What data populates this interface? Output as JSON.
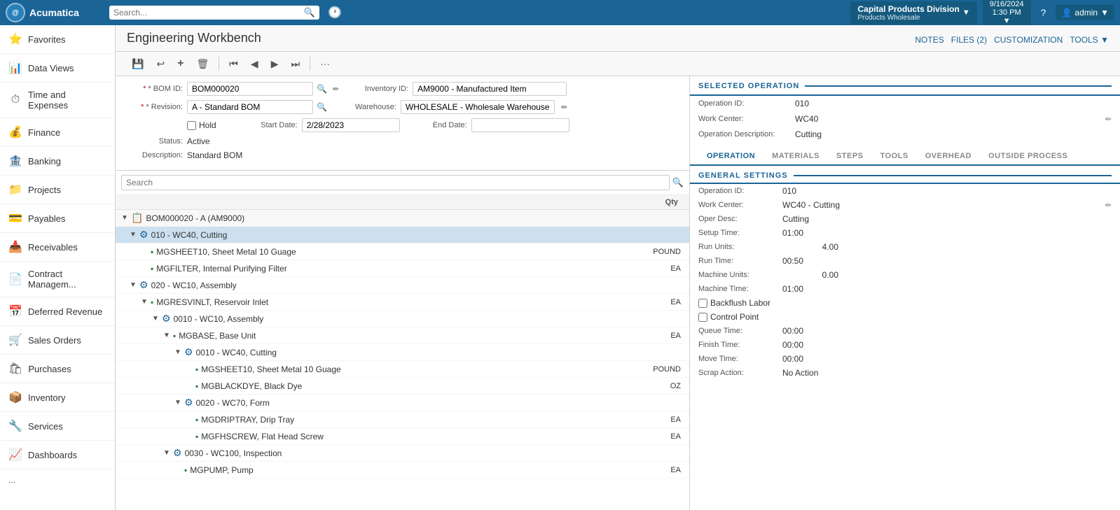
{
  "app": {
    "name": "Acumatica"
  },
  "topnav": {
    "search_placeholder": "Search...",
    "company": "Capital Products Division",
    "division": "Products Wholesale",
    "date": "9/16/2024",
    "time": "1:30 PM",
    "help_label": "?",
    "user": "admin"
  },
  "page": {
    "title": "Engineering Workbench",
    "actions": {
      "notes": "NOTES",
      "files": "FILES (2)",
      "customization": "CUSTOMIZATION",
      "tools": "TOOLS"
    }
  },
  "sidebar": {
    "items": [
      {
        "id": "favorites",
        "label": "Favorites",
        "icon": "⭐"
      },
      {
        "id": "data-views",
        "label": "Data Views",
        "icon": "📊"
      },
      {
        "id": "time-expenses",
        "label": "Time and Expenses",
        "icon": "⏱"
      },
      {
        "id": "finance",
        "label": "Finance",
        "icon": "💰"
      },
      {
        "id": "banking",
        "label": "Banking",
        "icon": "🏦"
      },
      {
        "id": "projects",
        "label": "Projects",
        "icon": "📁"
      },
      {
        "id": "payables",
        "label": "Payables",
        "icon": "💳"
      },
      {
        "id": "receivables",
        "label": "Receivables",
        "icon": "📥"
      },
      {
        "id": "contract-mgmt",
        "label": "Contract Managem...",
        "icon": "📄"
      },
      {
        "id": "deferred-revenue",
        "label": "Deferred Revenue",
        "icon": "📅"
      },
      {
        "id": "sales-orders",
        "label": "Sales Orders",
        "icon": "🛒"
      },
      {
        "id": "purchases",
        "label": "Purchases",
        "icon": "🛍"
      },
      {
        "id": "inventory",
        "label": "Inventory",
        "icon": "📦"
      },
      {
        "id": "services",
        "label": "Services",
        "icon": "🔧"
      },
      {
        "id": "dashboards",
        "label": "Dashboards",
        "icon": "📈"
      }
    ],
    "more": "...",
    "collapse": "◀"
  },
  "form": {
    "bom_id_label": "* BOM ID:",
    "bom_id_value": "BOM000020",
    "revision_label": "* Revision:",
    "revision_value": "A - Standard BOM",
    "hold_label": "Hold",
    "hold_checked": false,
    "status_label": "Status:",
    "status_value": "Active",
    "description_label": "Description:",
    "description_value": "Standard BOM",
    "inventory_id_label": "Inventory ID:",
    "inventory_id_value": "AM9000 - Manufactured Item",
    "warehouse_label": "Warehouse:",
    "warehouse_value": "WHOLESALE - Wholesale Warehouse",
    "start_date_label": "Start Date:",
    "start_date_value": "2/28/2023",
    "end_date_label": "End Date:",
    "end_date_value": ""
  },
  "tree": {
    "search_placeholder": "Search",
    "col_qty": "Qty",
    "rows": [
      {
        "id": "bom-root",
        "indent": 0,
        "expand": "▼",
        "icon": "📋",
        "label": "BOM000020 - A (AM9000)",
        "qty": "",
        "type": "bom-header"
      },
      {
        "id": "op-010",
        "indent": 1,
        "expand": "▼",
        "icon": "⚙",
        "label": "010 - WC40, Cutting",
        "qty": "",
        "type": "operation",
        "selected": true
      },
      {
        "id": "mat-mgsheet10",
        "indent": 2,
        "expand": "",
        "icon": "🟩",
        "label": "MGSHEET10, Sheet Metal 10 Guage",
        "qty": "POUND",
        "type": "material"
      },
      {
        "id": "mat-mgfilter",
        "indent": 2,
        "expand": "",
        "icon": "🟩",
        "label": "MGFILTER, Internal Purifying Filter",
        "qty": "EA",
        "type": "material"
      },
      {
        "id": "op-020",
        "indent": 1,
        "expand": "▼",
        "icon": "⚙",
        "label": "020 - WC10, Assembly",
        "qty": "",
        "type": "operation"
      },
      {
        "id": "mat-mgresvnlt",
        "indent": 2,
        "expand": "▼",
        "icon": "🟩",
        "label": "MGRESVINLT, Reservoir Inlet",
        "qty": "EA",
        "type": "material"
      },
      {
        "id": "sub-0010",
        "indent": 3,
        "expand": "▼",
        "icon": "⚙",
        "label": "0010 - WC10, Assembly",
        "qty": "",
        "type": "sub-op"
      },
      {
        "id": "mat-mgbase",
        "indent": 4,
        "expand": "▼",
        "icon": "🟩",
        "label": "MGBASE, Base Unit",
        "qty": "EA",
        "type": "material"
      },
      {
        "id": "sub-0010b",
        "indent": 5,
        "expand": "▼",
        "icon": "⚙",
        "label": "0010 - WC40, Cutting",
        "qty": "",
        "type": "sub-op"
      },
      {
        "id": "mat-mgsheet10b",
        "indent": 6,
        "expand": "",
        "icon": "🟩",
        "label": "MGSHEET10, Sheet Metal 10 Guage",
        "qty": "POUND",
        "type": "material"
      },
      {
        "id": "mat-mgblackdye",
        "indent": 6,
        "expand": "",
        "icon": "🟩",
        "label": "MGBLACKDYE, Black Dye",
        "qty": "OZ",
        "type": "material"
      },
      {
        "id": "sub-0020",
        "indent": 5,
        "expand": "▼",
        "icon": "⚙",
        "label": "0020 - WC70, Form",
        "qty": "",
        "type": "sub-op"
      },
      {
        "id": "mat-mgdriptray",
        "indent": 6,
        "expand": "",
        "icon": "🟩",
        "label": "MGDRIPTRAY, Drip Tray",
        "qty": "EA",
        "type": "material"
      },
      {
        "id": "mat-mgfhscrew",
        "indent": 6,
        "expand": "",
        "icon": "🟩",
        "label": "MGFHSCREW, Flat Head Screw",
        "qty": "EA",
        "type": "material"
      },
      {
        "id": "sub-0030",
        "indent": 4,
        "expand": "▼",
        "icon": "⚙",
        "label": "0030 - WC100, Inspection",
        "qty": "",
        "type": "sub-op"
      },
      {
        "id": "mat-mgpump",
        "indent": 5,
        "expand": "",
        "icon": "🟩",
        "label": "MGPUMP, Pump",
        "qty": "EA",
        "type": "material"
      }
    ]
  },
  "right_panel": {
    "selected_operation": {
      "header": "SELECTED OPERATION",
      "operation_id_label": "Operation ID:",
      "operation_id_value": "010",
      "work_center_label": "Work Center:",
      "work_center_value": "WC40",
      "operation_description_label": "Operation Description:",
      "operation_description_value": "Cutting"
    },
    "tabs": [
      {
        "id": "operation",
        "label": "OPERATION",
        "active": true
      },
      {
        "id": "materials",
        "label": "MATERIALS",
        "active": false
      },
      {
        "id": "steps",
        "label": "STEPS",
        "active": false
      },
      {
        "id": "tools",
        "label": "TOOLS",
        "active": false
      },
      {
        "id": "overhead",
        "label": "OVERHEAD",
        "active": false
      },
      {
        "id": "outside-process",
        "label": "OUTSIDE PROCESS",
        "active": false
      }
    ],
    "general_settings": {
      "header": "GENERAL SETTINGS",
      "operation_id_label": "Operation ID:",
      "operation_id_value": "010",
      "work_center_label": "Work Center:",
      "work_center_value": "WC40 - Cutting",
      "oper_desc_label": "Oper Desc:",
      "oper_desc_value": "Cutting",
      "setup_time_label": "Setup Time:",
      "setup_time_value": "01:00",
      "run_units_label": "Run Units:",
      "run_units_value": "4.00",
      "run_time_label": "Run Time:",
      "run_time_value": "00:50",
      "machine_units_label": "Machine Units:",
      "machine_units_value": "0.00",
      "machine_time_label": "Machine Time:",
      "machine_time_value": "01:00",
      "backflush_labor_label": "Backflush Labor",
      "backflush_labor_checked": false,
      "control_point_label": "Control Point",
      "control_point_checked": false,
      "queue_time_label": "Queue Time:",
      "queue_time_value": "00:00",
      "finish_time_label": "Finish Time:",
      "finish_time_value": "00:00",
      "move_time_label": "Move Time:",
      "move_time_value": "00:00",
      "scrap_action_label": "Scrap Action:",
      "scrap_action_value": "No Action"
    }
  },
  "toolbar": {
    "buttons": [
      {
        "id": "save",
        "icon": "💾",
        "tooltip": "Save"
      },
      {
        "id": "undo",
        "icon": "↩",
        "tooltip": "Undo"
      },
      {
        "id": "add",
        "icon": "+",
        "tooltip": "Add"
      },
      {
        "id": "delete",
        "icon": "🗑",
        "tooltip": "Delete"
      },
      {
        "id": "first",
        "icon": "⏮",
        "tooltip": "First"
      },
      {
        "id": "prev",
        "icon": "◀",
        "tooltip": "Previous"
      },
      {
        "id": "next",
        "icon": "▶",
        "tooltip": "Next"
      },
      {
        "id": "last",
        "icon": "⏭",
        "tooltip": "Last"
      },
      {
        "id": "more",
        "icon": "···",
        "tooltip": "More"
      }
    ]
  }
}
